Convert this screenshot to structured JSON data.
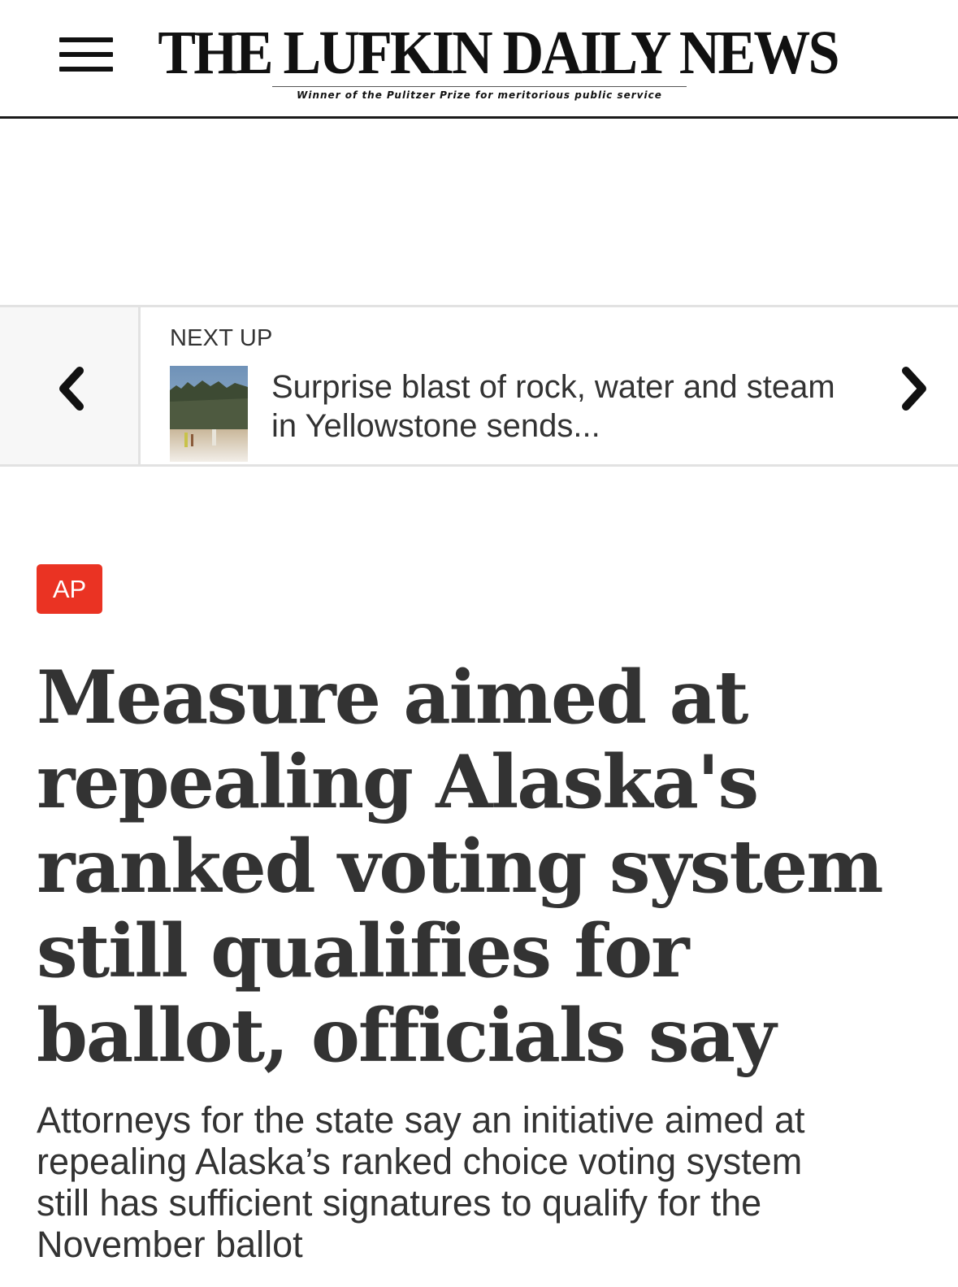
{
  "header": {
    "menu_icon": "hamburger-menu-icon",
    "title": "THE LUFKIN DAILY NEWS",
    "tagline": "Winner of the Pulitzer Prize for meritorious public service"
  },
  "next_up": {
    "label": "NEXT UP",
    "headline": "Surprise blast of rock, water and steam in Yellowstone sends...",
    "prev_icon": "chevron-left-icon",
    "next_icon": "chevron-right-icon"
  },
  "article": {
    "source_badge": "AP",
    "headline": "Measure aimed at repealing Alaska's ranked voting system still qualifies for ballot, officials say",
    "summary": "Attorneys for the state say an initiative aimed at repealing Alaska’s ranked choice voting system still has sufficient signatures to qualify for the November ballot"
  },
  "colors": {
    "badge_red": "#ea3323",
    "text": "#333333",
    "header_rule": "#1a1a1a"
  }
}
